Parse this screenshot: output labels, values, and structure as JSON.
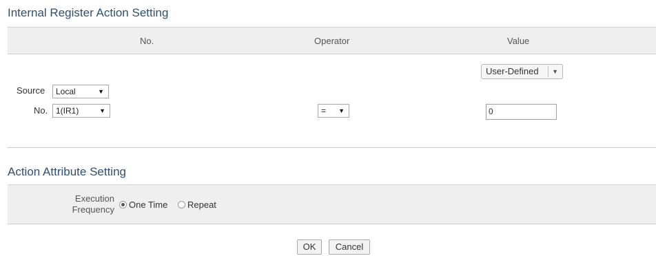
{
  "register_section": {
    "title": "Internal Register Action Setting",
    "columns": {
      "no": "No.",
      "operator": "Operator",
      "value": "Value"
    },
    "source_label": "Source",
    "source_value": "Local",
    "no_label": "No.",
    "no_value": "1(IR1)",
    "operator_value": "=",
    "value_type": "User-Defined",
    "value_input": "0"
  },
  "attribute_section": {
    "title": "Action Attribute Setting",
    "label_line1": "Execution",
    "label_line2": "Frequency",
    "options": [
      {
        "label": "One Time",
        "checked": true
      },
      {
        "label": "Repeat",
        "checked": false
      }
    ]
  },
  "buttons": {
    "ok": "OK",
    "cancel": "Cancel"
  }
}
